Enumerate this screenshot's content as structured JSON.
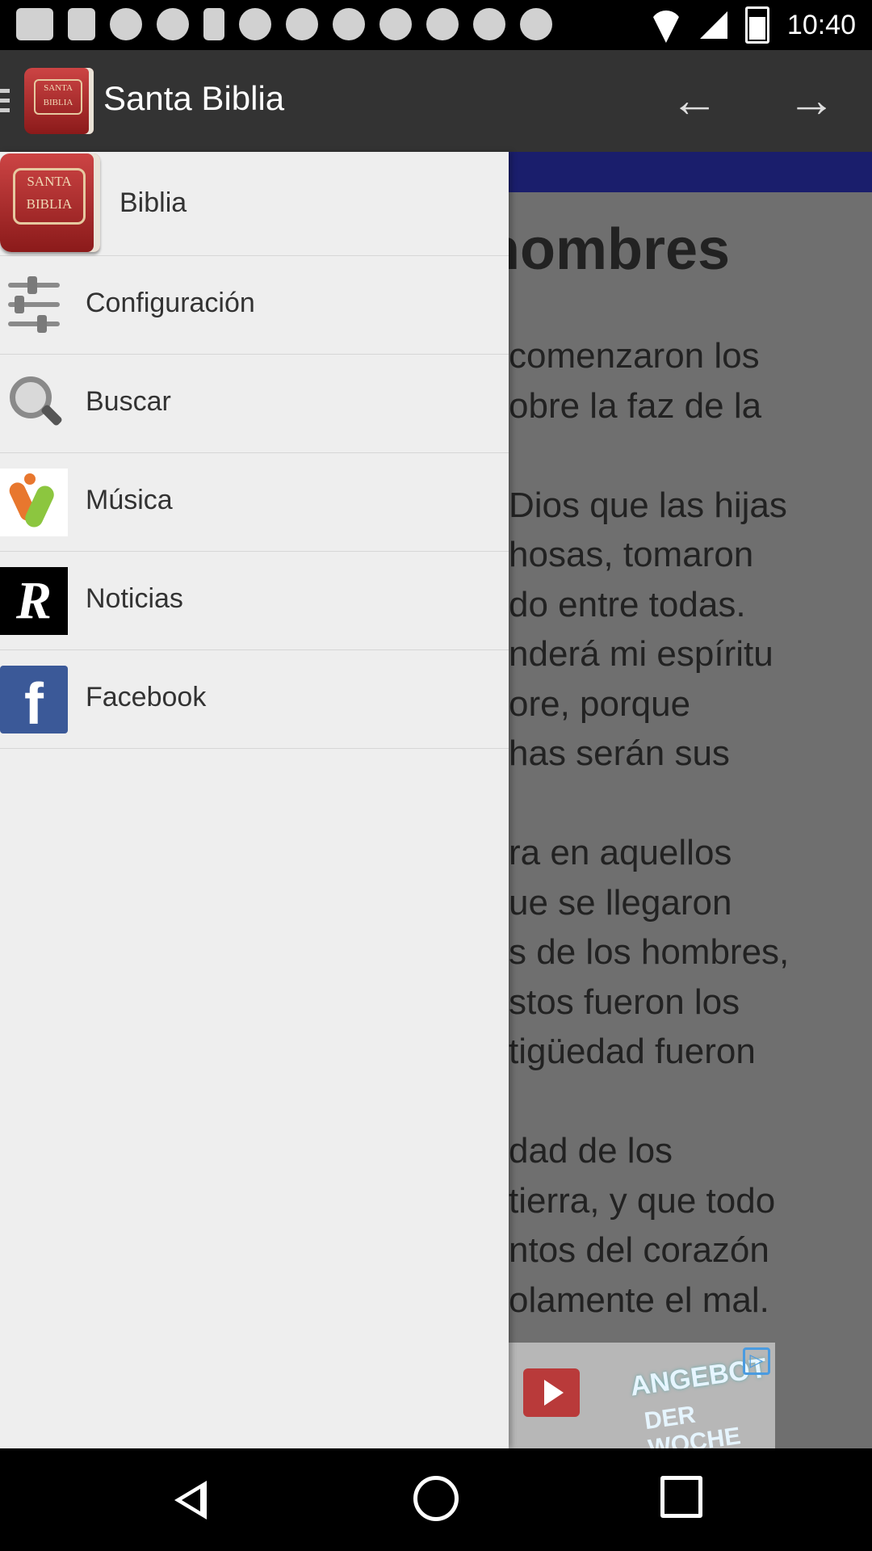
{
  "status_bar": {
    "time": "10:40",
    "notification_icons": [
      "message-icon",
      "flipboard-icon",
      "abc-icon",
      "abc-icon",
      "pin-icon",
      "abc-icon",
      "abc-icon",
      "abc-icon",
      "abc-icon",
      "abc-icon",
      "abc-icon",
      "abc-icon"
    ]
  },
  "app_bar": {
    "title": "Santa Biblia",
    "logo_text": "SANTA BIBLIA",
    "back_arrow": "←",
    "forward_arrow": "→"
  },
  "drawer": {
    "header": {
      "label": "Biblia",
      "logo_text": "SANTA BIBLIA"
    },
    "items": [
      {
        "label": "Configuración",
        "icon": "sliders-icon"
      },
      {
        "label": "Buscar",
        "icon": "search-icon"
      },
      {
        "label": "Música",
        "icon": "music-app-icon"
      },
      {
        "label": "Noticias",
        "icon": "news-app-icon",
        "icon_glyph": "R"
      },
      {
        "label": "Facebook",
        "icon": "facebook-icon",
        "icon_glyph": "f"
      }
    ]
  },
  "content": {
    "heading": "hombres",
    "lines": [
      "comenzaron los",
      "obre la faz de la",
      "",
      "Dios que las hijas",
      "hosas, tomaron",
      "do entre todas.",
      "nderá mi espíritu",
      "ore, porque",
      "has serán sus",
      "",
      "ra en aquellos",
      "ue se llegaron",
      "s de los hombres,",
      "stos fueron los",
      "tigüedad fueron",
      "",
      "dad de los",
      "tierra, y que todo",
      "ntos del corazón",
      "olamente el mal."
    ]
  },
  "ad": {
    "line1": "ANGEBOT",
    "line2": "DER WOCHE"
  },
  "colors": {
    "app_bar": "#333333",
    "drawer_bg": "#eeeeee",
    "content_overlay": "#6f6f6f",
    "content_strip": "#1a1e6c",
    "facebook_blue": "#3b5998"
  }
}
